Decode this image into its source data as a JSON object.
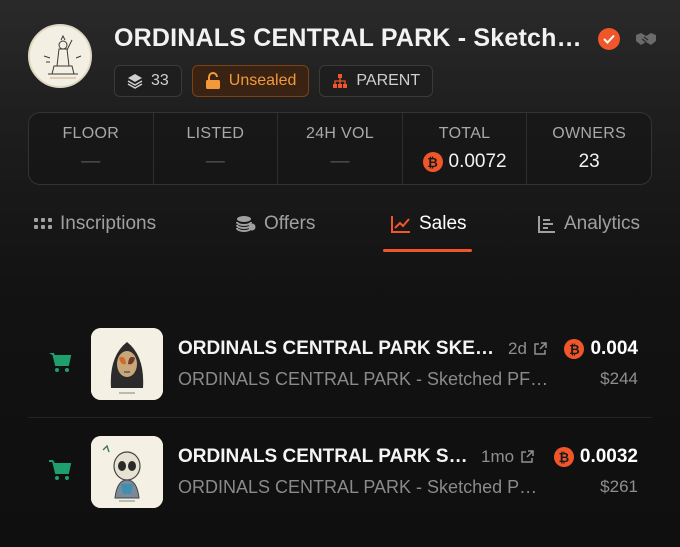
{
  "collection": {
    "title": "ORDINALS CENTRAL PARK - Sketch…",
    "avatar_icon": "statue-sketch-image"
  },
  "chips": {
    "count": "33",
    "status": "Unsealed",
    "parent": "PARENT"
  },
  "stats": [
    {
      "label": "FLOOR",
      "value": "—"
    },
    {
      "label": "LISTED",
      "value": "—"
    },
    {
      "label": "24H VOL",
      "value": "—"
    },
    {
      "label": "TOTAL",
      "value": "0.0072"
    },
    {
      "label": "OWNERS",
      "value": "23"
    }
  ],
  "tabs": [
    {
      "label": "Inscriptions",
      "icon": "grid-dots-icon"
    },
    {
      "label": "Offers",
      "icon": "coins-icon"
    },
    {
      "label": "Sales",
      "icon": "trend-chart-icon",
      "active": true
    },
    {
      "label": "Analytics",
      "icon": "bar-chart-icon"
    }
  ],
  "sales": [
    {
      "name": "ORDINALS CENTRAL PARK SKE…",
      "age": "2d",
      "collection": "ORDINALS CENTRAL PARK - Sketched PF…",
      "price": "0.004",
      "usd": "$244"
    },
    {
      "name": "ORDINALS CENTRAL PARK S…",
      "age": "1mo",
      "collection": "ORDINALS CENTRAL PARK - Sketched P…",
      "price": "0.0032",
      "usd": "$261"
    }
  ],
  "colors": {
    "accent": "#f0562a",
    "unsealed": "#f29a3a",
    "cart": "#1f9e6e"
  }
}
